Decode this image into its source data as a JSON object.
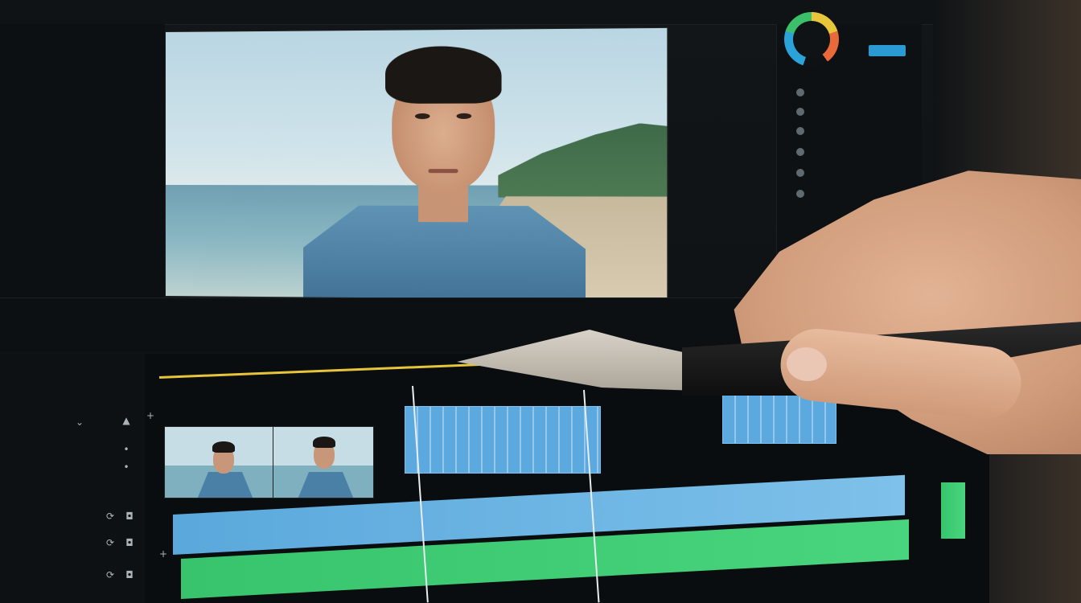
{
  "topbar": {
    "label": ""
  },
  "viewer": {
    "caption_left": "",
    "caption_right": ""
  },
  "transport": {
    "timecode_left": "",
    "timecode_green": "",
    "play_label": "",
    "mark_in": "",
    "mark_out": ""
  },
  "timeline": {
    "ruler": [],
    "track_title": "",
    "clip_label": ""
  },
  "left_panel": {
    "rows": []
  },
  "right_panel": {
    "items": []
  },
  "colors": {
    "playhead_yellow": "#e6c53b",
    "video_clip_blue": "#5ba9df",
    "audio_blue": "#5aa8dc",
    "audio_green": "#37c46c",
    "accent_timecode": "#3fd08a"
  }
}
